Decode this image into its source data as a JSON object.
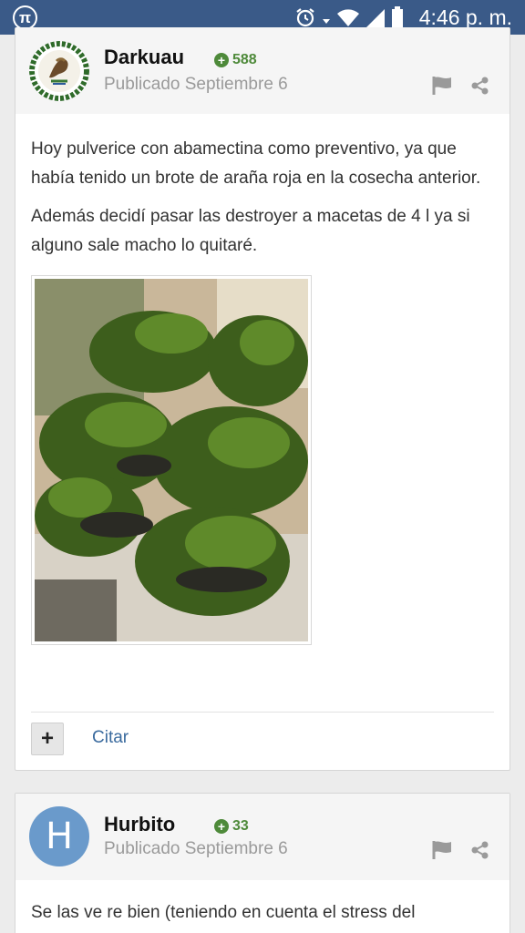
{
  "status_bar": {
    "app_icon": "pi-icon",
    "time": "4:46 p. m."
  },
  "posts": [
    {
      "author": "Darkuau",
      "reputation": "588",
      "posted": "Publicado Septiembre 6",
      "paragraphs": [
        "Hoy pulverice con abamectina como preventivo, ya que había tenido un brote de araña roja en la cosecha anterior.",
        "Además decidí pasar las destroyer a macetas de 4 l ya si alguno sale macho lo quitaré."
      ],
      "plus_label": "+",
      "quote_label": "Citar"
    },
    {
      "author": "Hurbito",
      "avatar_letter": "H",
      "reputation": "33",
      "posted": "Publicado Septiembre 6",
      "paragraphs": [
        "Se las ve re bien (teniendo en cuenta el stress del"
      ]
    }
  ],
  "colors": {
    "status_bar": "#3a5a88",
    "reputation": "#4e8a3a",
    "link": "#3a6a9e",
    "avatar_bg": "#6a9acb"
  }
}
